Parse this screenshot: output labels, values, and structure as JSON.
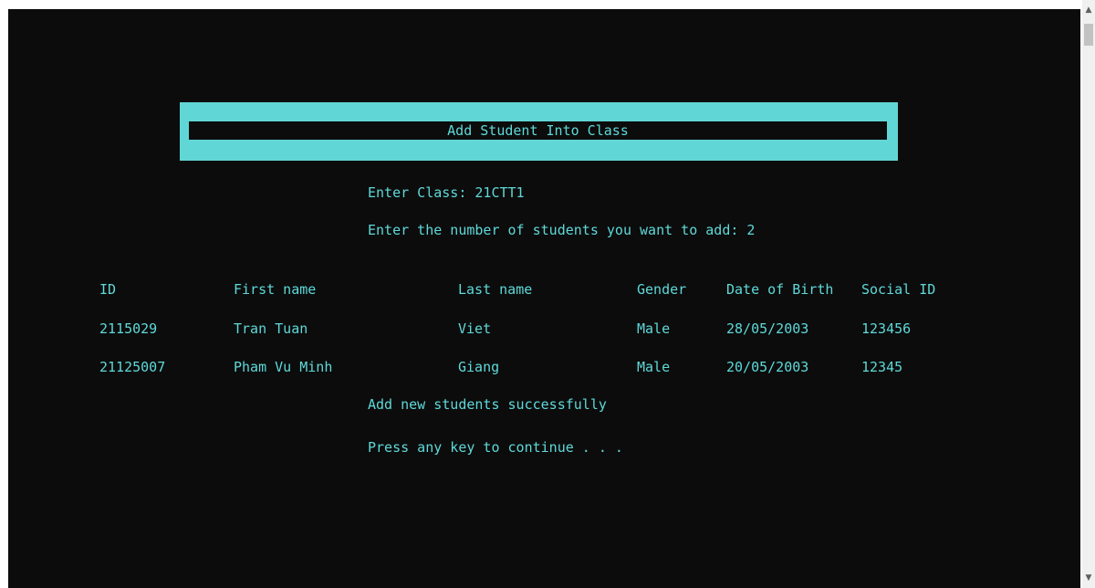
{
  "console": {
    "title": "Add Student Into Class",
    "class_prompt": "Enter Class: 21CTT1",
    "count_prompt": "Enter the number of students you want to add: 2",
    "headers": [
      "ID",
      "First name",
      "Last name",
      "Gender",
      "Date of Birth",
      "Social ID"
    ],
    "rows": [
      [
        "2115029",
        "Tran Tuan",
        "Viet",
        "Male",
        "28/05/2003",
        "123456"
      ],
      [
        "21125007",
        "Pham Vu Minh",
        "Giang",
        "Male",
        "20/05/2003",
        "12345"
      ]
    ],
    "success_message": "Add new students successfully",
    "continue_prompt": "Press any key to continue . . ."
  },
  "colors": {
    "background": "#0c0c0c",
    "text": "#5fd9d9",
    "title_band": "#61d6d6"
  },
  "scrollbar": {
    "up_icon": "chevron-up-icon",
    "down_icon": "chevron-down-icon"
  }
}
